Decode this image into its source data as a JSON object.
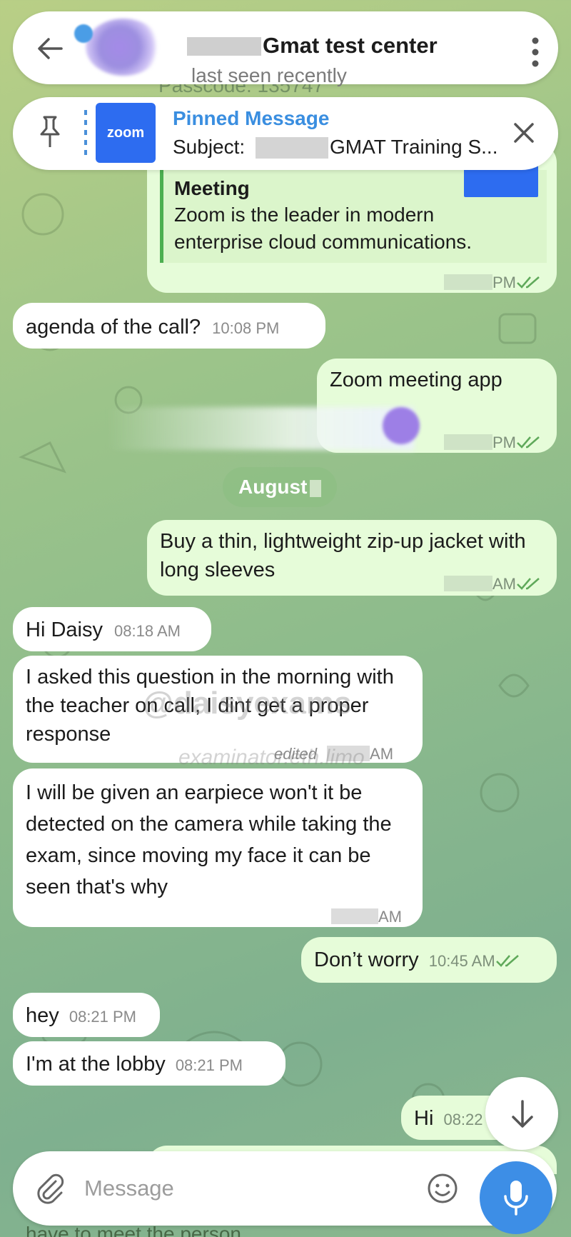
{
  "colors": {
    "outgoing_bubble": "#e6fcd9",
    "incoming_bubble": "#ffffff",
    "accent": "#3a8ee0",
    "mic_button": "#3d8ee6"
  },
  "header": {
    "back_icon": "arrow-left-icon",
    "title": "Gmat test center",
    "status": "last seen recently",
    "more_icon": "more-vertical-icon"
  },
  "background_text": "Passcode: 135747",
  "pinned": {
    "label": "Pinned Message",
    "subject_prefix": "Subject:",
    "subject_rest": "GMAT Training S...",
    "thumb_label": "zoom",
    "close_icon": "close-icon",
    "pin_icon": "pin-icon"
  },
  "messages": [
    {
      "dir": "out",
      "preview_title": "Meeting",
      "preview_text": "Zoom is the leader in modern enterprise cloud communications.",
      "time": "PM"
    },
    {
      "dir": "in",
      "text": "agenda of the call?",
      "time": "10:08 PM"
    },
    {
      "dir": "out",
      "text": "Zoom meeting app",
      "time": "PM"
    },
    {
      "date": "August"
    },
    {
      "dir": "out",
      "text": "Buy a thin, lightweight zip-up jacket with long sleeves",
      "time": "AM"
    },
    {
      "dir": "in",
      "text": "Hi Daisy",
      "time": "08:18 AM"
    },
    {
      "dir": "in",
      "text": "I asked this question in the morning with the teacher on call, I dint get a proper response",
      "edited": "edited",
      "time": "AM"
    },
    {
      "dir": "in",
      "text": "I will be given an earpiece won't it be detected on the camera while taking the exam, since moving my face it can be seen that's why",
      "time": "AM"
    },
    {
      "dir": "out",
      "text": "Don’t worry",
      "time": "10:45 AM"
    },
    {
      "dir": "in",
      "text": "hey",
      "time": "08:21 PM"
    },
    {
      "dir": "in",
      "text": "I'm at the lobby",
      "time": "08:21 PM"
    },
    {
      "dir": "out",
      "text": "Hi",
      "time": "08:22"
    }
  ],
  "watermark": {
    "line1": "@daisyexams",
    "line2": "examinator.eth.limo"
  },
  "composer": {
    "placeholder": "Message",
    "attach_icon": "paperclip-icon",
    "emoji_icon": "emoji-icon",
    "mic_icon": "microphone-icon"
  },
  "scroll_icon": "arrow-down-icon",
  "bottom_text": "have to meet the person"
}
